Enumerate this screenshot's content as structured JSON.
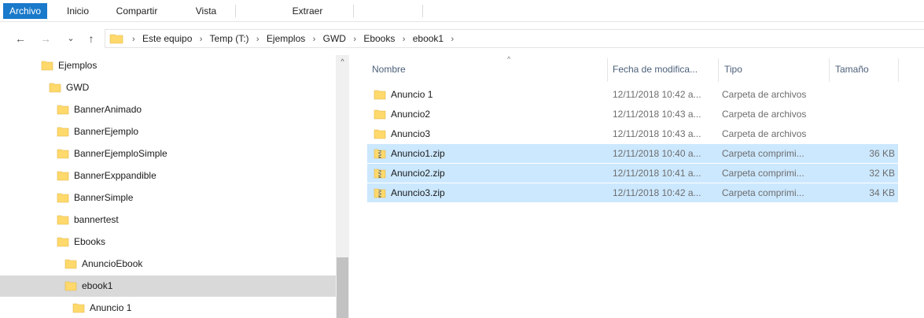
{
  "ribbon": {
    "tabs": [
      {
        "label": "Archivo",
        "active": true
      },
      {
        "label": "Inicio",
        "active": false
      },
      {
        "label": "Compartir",
        "active": false
      },
      {
        "label": "Vista",
        "active": false
      },
      {
        "label": "Extraer",
        "active": false
      }
    ]
  },
  "nav": {
    "back_glyph": "←",
    "forward_glyph": "→",
    "recent_glyph": "⌄",
    "up_glyph": "↑",
    "separator_glyph": "›",
    "breadcrumbs": [
      "Este equipo",
      "Temp (T:)",
      "Ejemplos",
      "GWD",
      "Ebooks",
      "ebook1"
    ]
  },
  "tree": {
    "items": [
      {
        "label": "Ejemplos",
        "level": 0,
        "selected": false
      },
      {
        "label": "GWD",
        "level": 1,
        "selected": false
      },
      {
        "label": "BannerAnimado",
        "level": 2,
        "selected": false
      },
      {
        "label": "BannerEjemplo",
        "level": 2,
        "selected": false
      },
      {
        "label": "BannerEjemploSimple",
        "level": 2,
        "selected": false
      },
      {
        "label": "BannerExppandible",
        "level": 2,
        "selected": false
      },
      {
        "label": "BannerSimple",
        "level": 2,
        "selected": false
      },
      {
        "label": "bannertest",
        "level": 2,
        "selected": false
      },
      {
        "label": "Ebooks",
        "level": 2,
        "selected": false
      },
      {
        "label": "AnuncioEbook",
        "level": 3,
        "selected": false
      },
      {
        "label": "ebook1",
        "level": 3,
        "selected": true
      },
      {
        "label": "Anuncio 1",
        "level": 4,
        "selected": false
      }
    ],
    "scroll_up_glyph": "^"
  },
  "content": {
    "sort_glyph": "^",
    "columns": {
      "name": "Nombre",
      "date": "Fecha de modifica...",
      "type": "Tipo",
      "size": "Tamaño"
    },
    "files": [
      {
        "name": "Anuncio 1",
        "date": "12/11/2018 10:42 a...",
        "type": "Carpeta de archivos",
        "size": "",
        "icon": "folder-icon",
        "selected": false
      },
      {
        "name": "Anuncio2",
        "date": "12/11/2018 10:43 a...",
        "type": "Carpeta de archivos",
        "size": "",
        "icon": "folder-icon",
        "selected": false
      },
      {
        "name": "Anuncio3",
        "date": "12/11/2018 10:43 a...",
        "type": "Carpeta de archivos",
        "size": "",
        "icon": "folder-icon",
        "selected": false
      },
      {
        "name": "Anuncio1.zip",
        "date": "12/11/2018 10:40 a...",
        "type": "Carpeta comprimi...",
        "size": "36 KB",
        "icon": "zip-folder-icon",
        "selected": true
      },
      {
        "name": "Anuncio2.zip",
        "date": "12/11/2018 10:41 a...",
        "type": "Carpeta comprimi...",
        "size": "32 KB",
        "icon": "zip-folder-icon",
        "selected": true
      },
      {
        "name": "Anuncio3.zip",
        "date": "12/11/2018 10:42 a...",
        "type": "Carpeta comprimi...",
        "size": "34 KB",
        "icon": "zip-folder-icon",
        "selected": true
      }
    ]
  },
  "colors": {
    "accent": "#1979ca",
    "selection": "#cce8ff",
    "tree_selection": "#d9d9d9",
    "folder": "#ffd96b"
  }
}
